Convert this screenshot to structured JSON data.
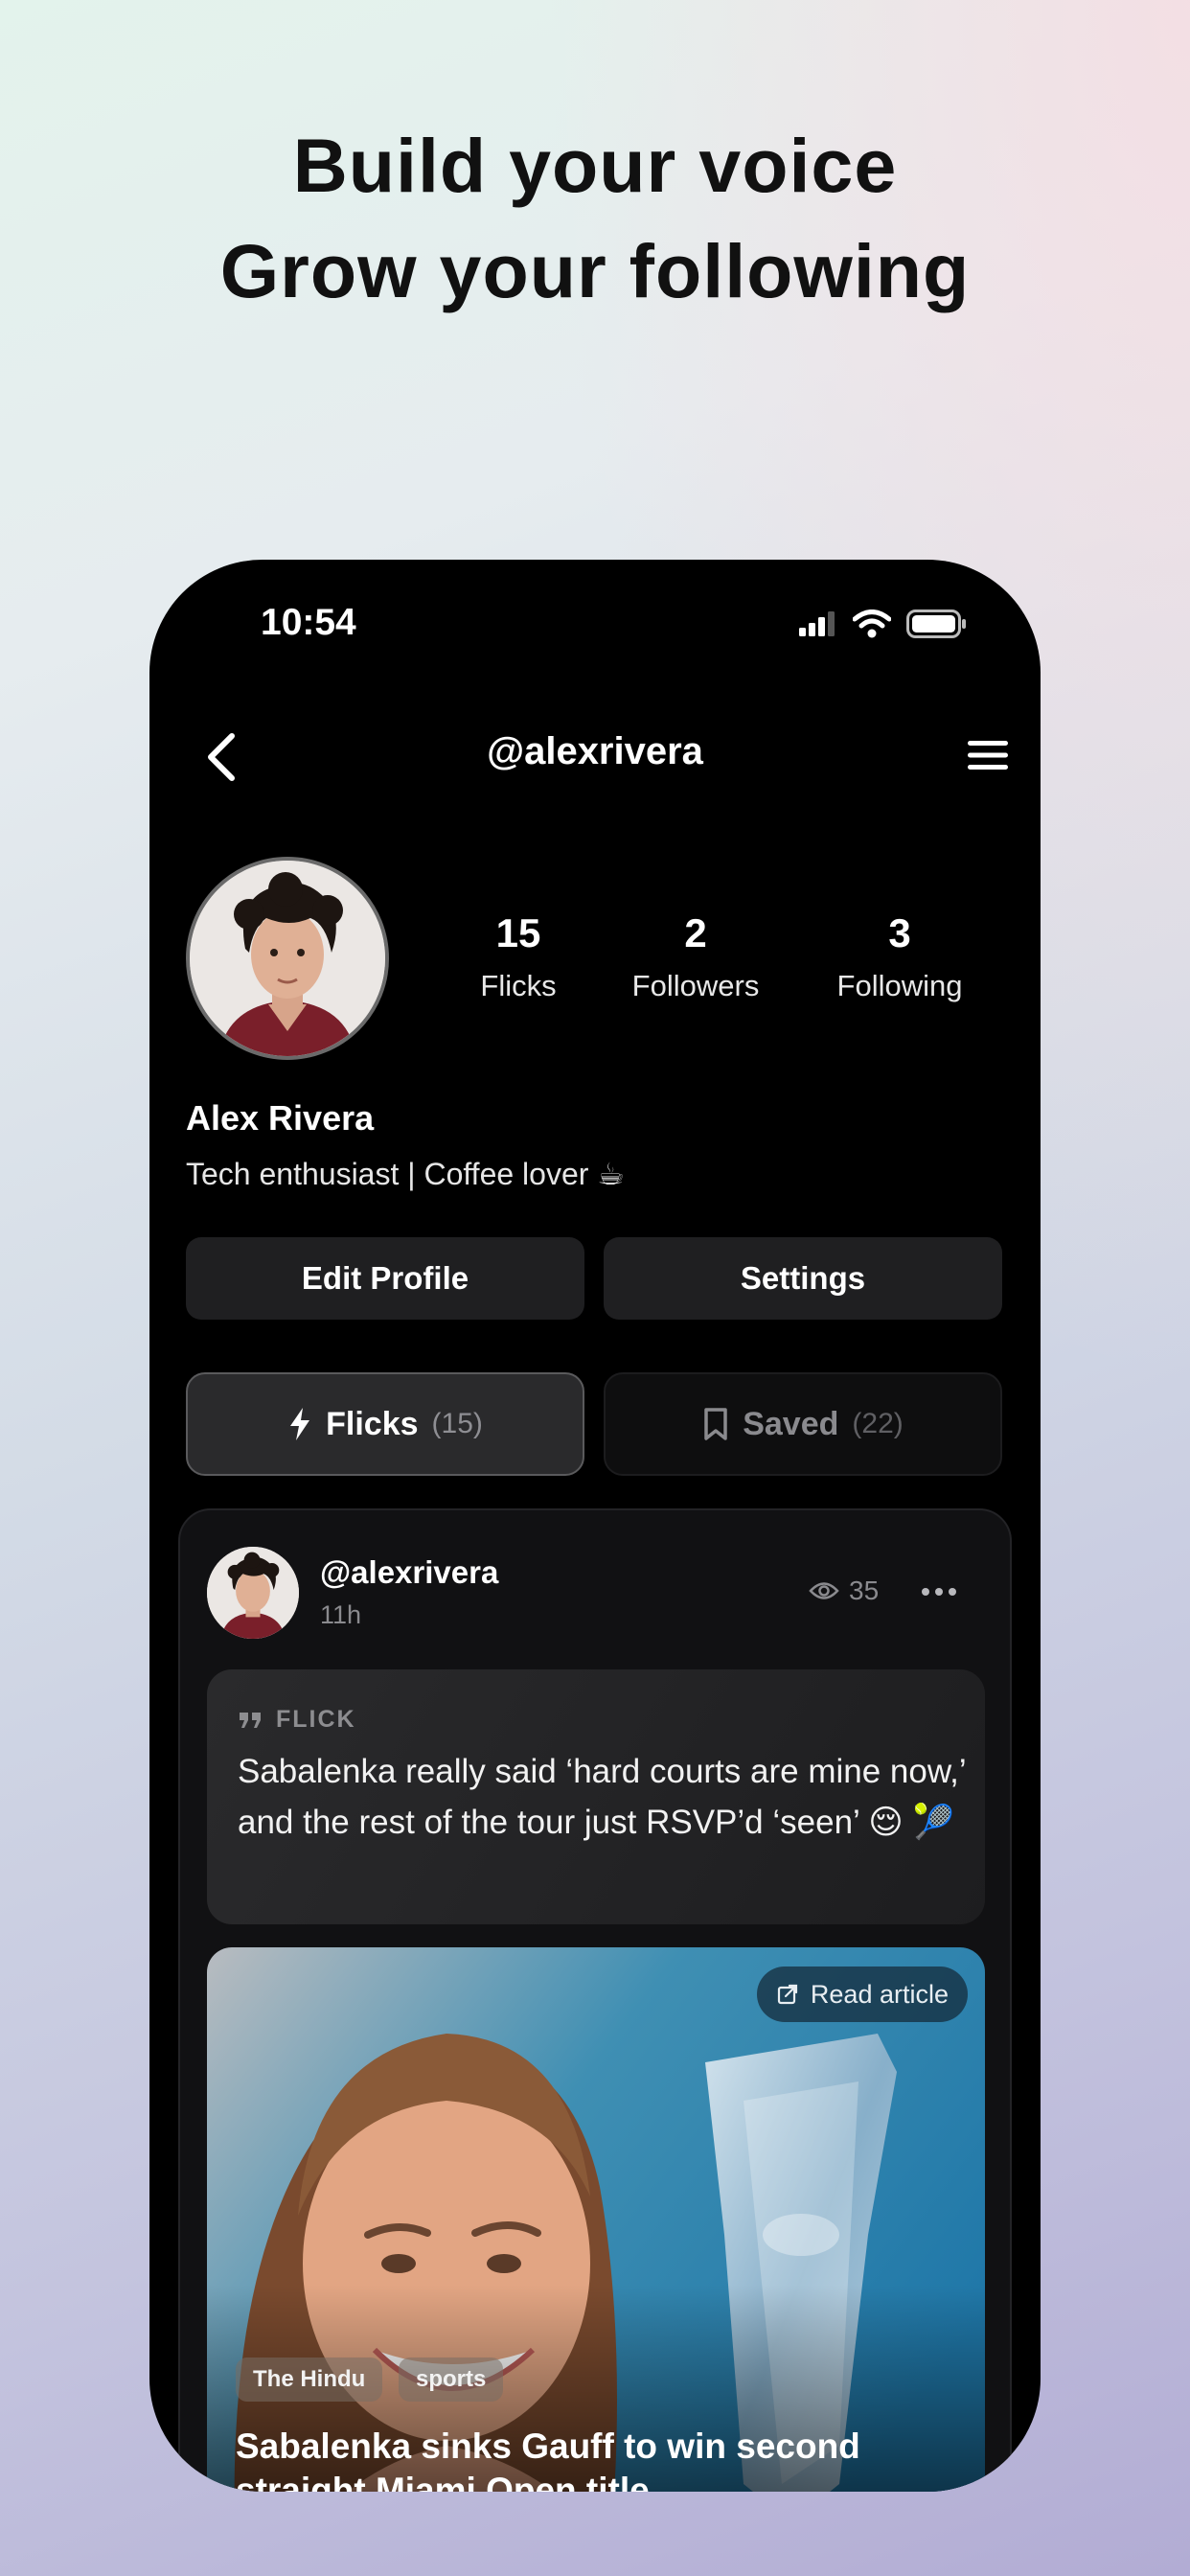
{
  "headline": {
    "line1": "Build your voice",
    "line2": "Grow your following"
  },
  "status_bar": {
    "time": "10:54",
    "icons": [
      "cellular-signal-icon",
      "wifi-icon",
      "battery-icon"
    ]
  },
  "nav": {
    "title": "@alexrivera",
    "back_icon": "chevron-left-icon",
    "menu_icon": "hamburger-menu-icon"
  },
  "profile": {
    "name": "Alex Rivera",
    "bio": "Tech enthusiast | Coffee lover ☕",
    "stats": [
      {
        "value": "15",
        "label": "Flicks"
      },
      {
        "value": "2",
        "label": "Followers"
      },
      {
        "value": "3",
        "label": "Following"
      }
    ]
  },
  "actions": {
    "edit_profile": "Edit Profile",
    "settings": "Settings"
  },
  "tabs": [
    {
      "label": "Flicks",
      "count": "(15)",
      "icon": "lightning-icon",
      "active": true
    },
    {
      "label": "Saved",
      "count": "(22)",
      "icon": "bookmark-icon",
      "active": false
    }
  ],
  "post": {
    "username": "@alexrivera",
    "time": "11h",
    "views": "35",
    "type_label": "FLICK",
    "text": "Sabalenka really said ‘hard courts are mine now,’ and the rest of the tour just RSVP’d ‘seen’ 😌 🎾",
    "article": {
      "read_label": "Read article",
      "tags": [
        "The Hindu",
        "sports"
      ],
      "title": "Sabalenka sinks Gauff to win second straight Miami Open title"
    }
  },
  "colors": {
    "phone_bg": "#000000",
    "button_bg": "#1f1f21",
    "muted_text": "#8a8a8e"
  }
}
